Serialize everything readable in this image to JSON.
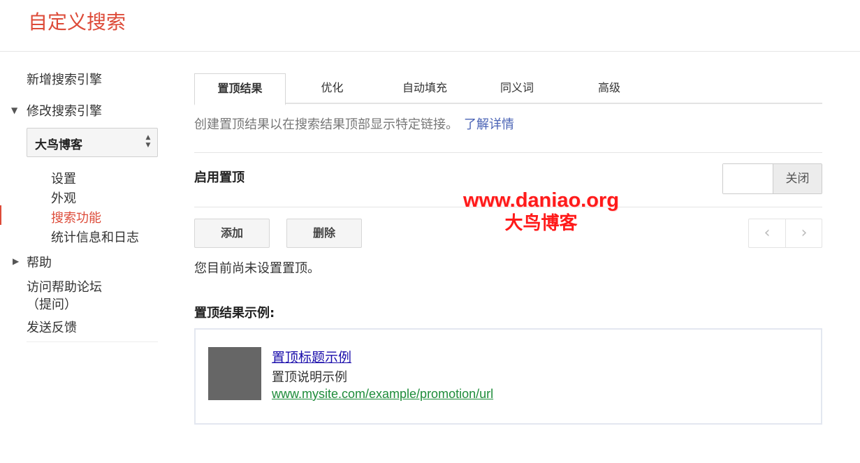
{
  "header": {
    "title": "自定义搜索"
  },
  "sidebar": {
    "new_engine": "新增搜索引擎",
    "edit_engine": "修改搜索引擎",
    "engine_select": {
      "value": "大鸟博客"
    },
    "sub_items": [
      "设置",
      "外观",
      "搜索功能",
      "统计信息和日志"
    ],
    "active_item": "搜索功能",
    "help": "帮助",
    "forum_line1": "访问帮助论坛",
    "forum_line2": "（提问）",
    "feedback": "发送反馈"
  },
  "tabs": [
    "置顶结果",
    "优化",
    "自动填充",
    "同义词",
    "高级"
  ],
  "intro": {
    "text": "创建置顶结果以在搜索结果顶部显示特定链接。",
    "link": "了解详情"
  },
  "enable": {
    "label": "启用置顶",
    "state": "关闭"
  },
  "actions": {
    "add": "添加",
    "delete": "删除"
  },
  "empty_message": "您目前尚未设置置顶。",
  "example": {
    "heading": "置顶结果示例:",
    "title": "置顶标题示例",
    "description": "置顶说明示例",
    "url": "www.mysite.com/example/promotion/url"
  },
  "watermark": {
    "url": "www.daniao.org",
    "name": "大鸟博客"
  },
  "colors": {
    "accent": "#dd4b39",
    "link": "#1a0dab",
    "url_green": "#1e8c3a",
    "watermark": "#ff1a1a"
  },
  "icons": {
    "expanded_arrow": "triangle-down-icon",
    "collapsed_arrow": "triangle-right-icon",
    "select_arrows": "updown-icon",
    "pager_prev": "chevron-left-icon",
    "pager_next": "chevron-right-icon"
  }
}
